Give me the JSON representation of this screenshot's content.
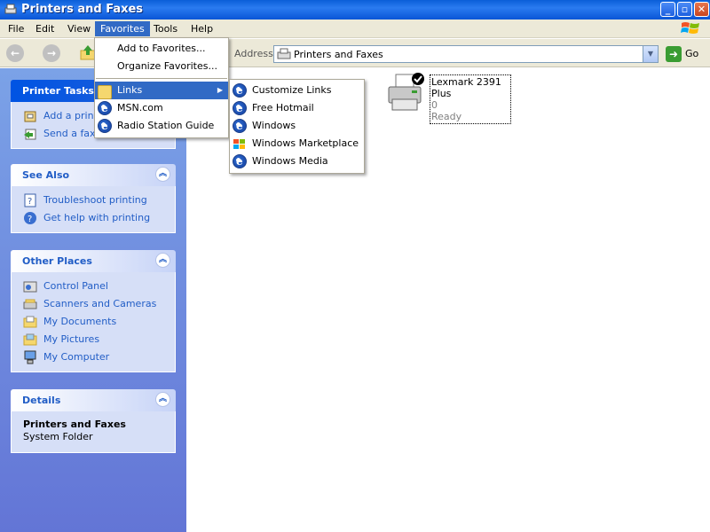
{
  "window": {
    "title": "Printers and Faxes"
  },
  "menubar": {
    "items": [
      "File",
      "Edit",
      "View",
      "Favorites",
      "Tools",
      "Help"
    ]
  },
  "toolbar": {
    "address_label": "Address",
    "address_value": "Printers and Faxes",
    "go_label": "Go"
  },
  "favorites_menu": {
    "items": [
      "Add to Favorites...",
      "Organize Favorites...",
      "Links",
      "MSN.com",
      "Radio Station Guide"
    ]
  },
  "links_submenu": {
    "items": [
      "Customize Links",
      "Free Hotmail",
      "Windows",
      "Windows Marketplace",
      "Windows Media"
    ]
  },
  "taskpane": {
    "printer_tasks": {
      "title": "Printer Tasks",
      "items": [
        "Add a printer",
        "Send a fax"
      ]
    },
    "see_also": {
      "title": "See Also",
      "items": [
        "Troubleshoot printing",
        "Get help with printing"
      ]
    },
    "other_places": {
      "title": "Other Places",
      "items": [
        "Control Panel",
        "Scanners and Cameras",
        "My Documents",
        "My Pictures",
        "My Computer"
      ]
    },
    "details": {
      "title": "Details",
      "name": "Printers and Faxes",
      "type": "System Folder"
    }
  },
  "printer": {
    "name": "Lexmark 2391 Plus",
    "count": "0",
    "status": "Ready"
  },
  "colors": {
    "title_bar": "#0a5ed8",
    "menu_highlight": "#316ac5",
    "taskpane_bg": "#6d8de0"
  }
}
